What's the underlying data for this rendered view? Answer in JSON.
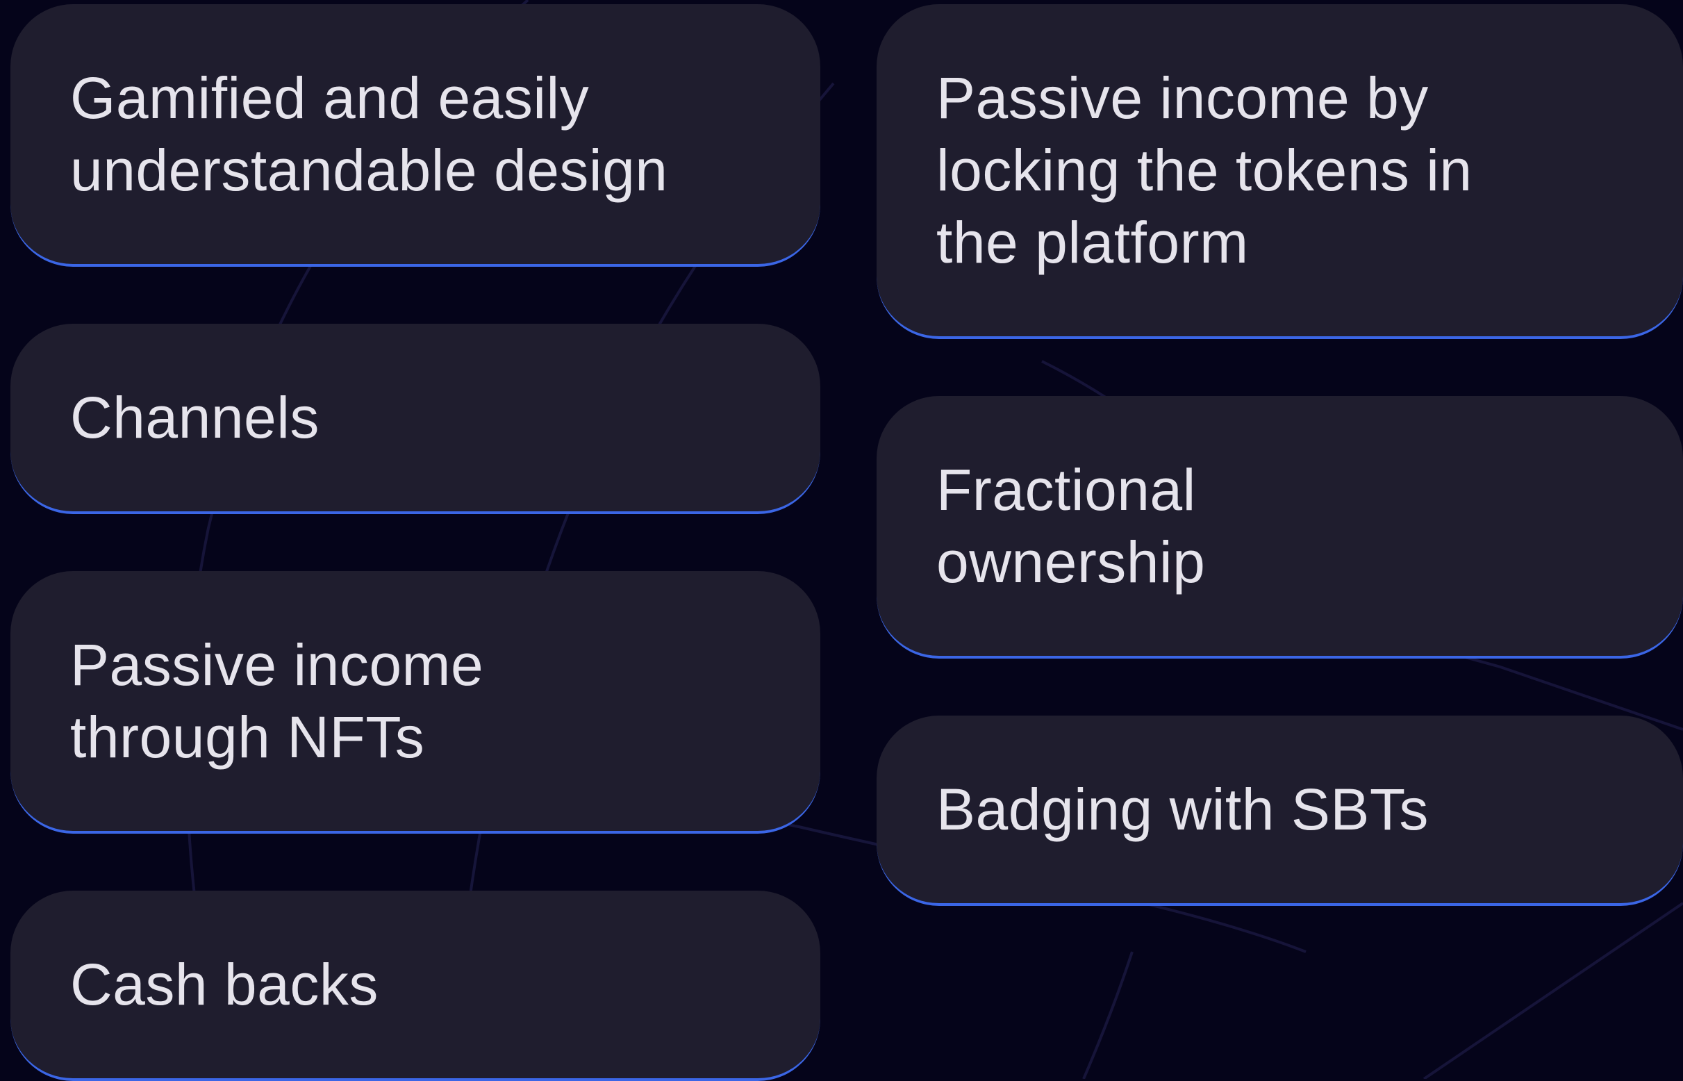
{
  "colors": {
    "background": "#05041a",
    "card_background": "#1f1d2e",
    "card_accent_border": "#3b66e6",
    "text": "#e6e4ec"
  },
  "left_column": [
    {
      "text": "Gamified and easily understandable design"
    },
    {
      "text": "Channels"
    },
    {
      "text": "Passive income through NFTs"
    },
    {
      "text": "Cash backs"
    }
  ],
  "right_column": [
    {
      "text": "Passive income by locking the tokens in the platform"
    },
    {
      "text": "Fractional ownership"
    },
    {
      "text": "Badging with SBTs"
    }
  ]
}
